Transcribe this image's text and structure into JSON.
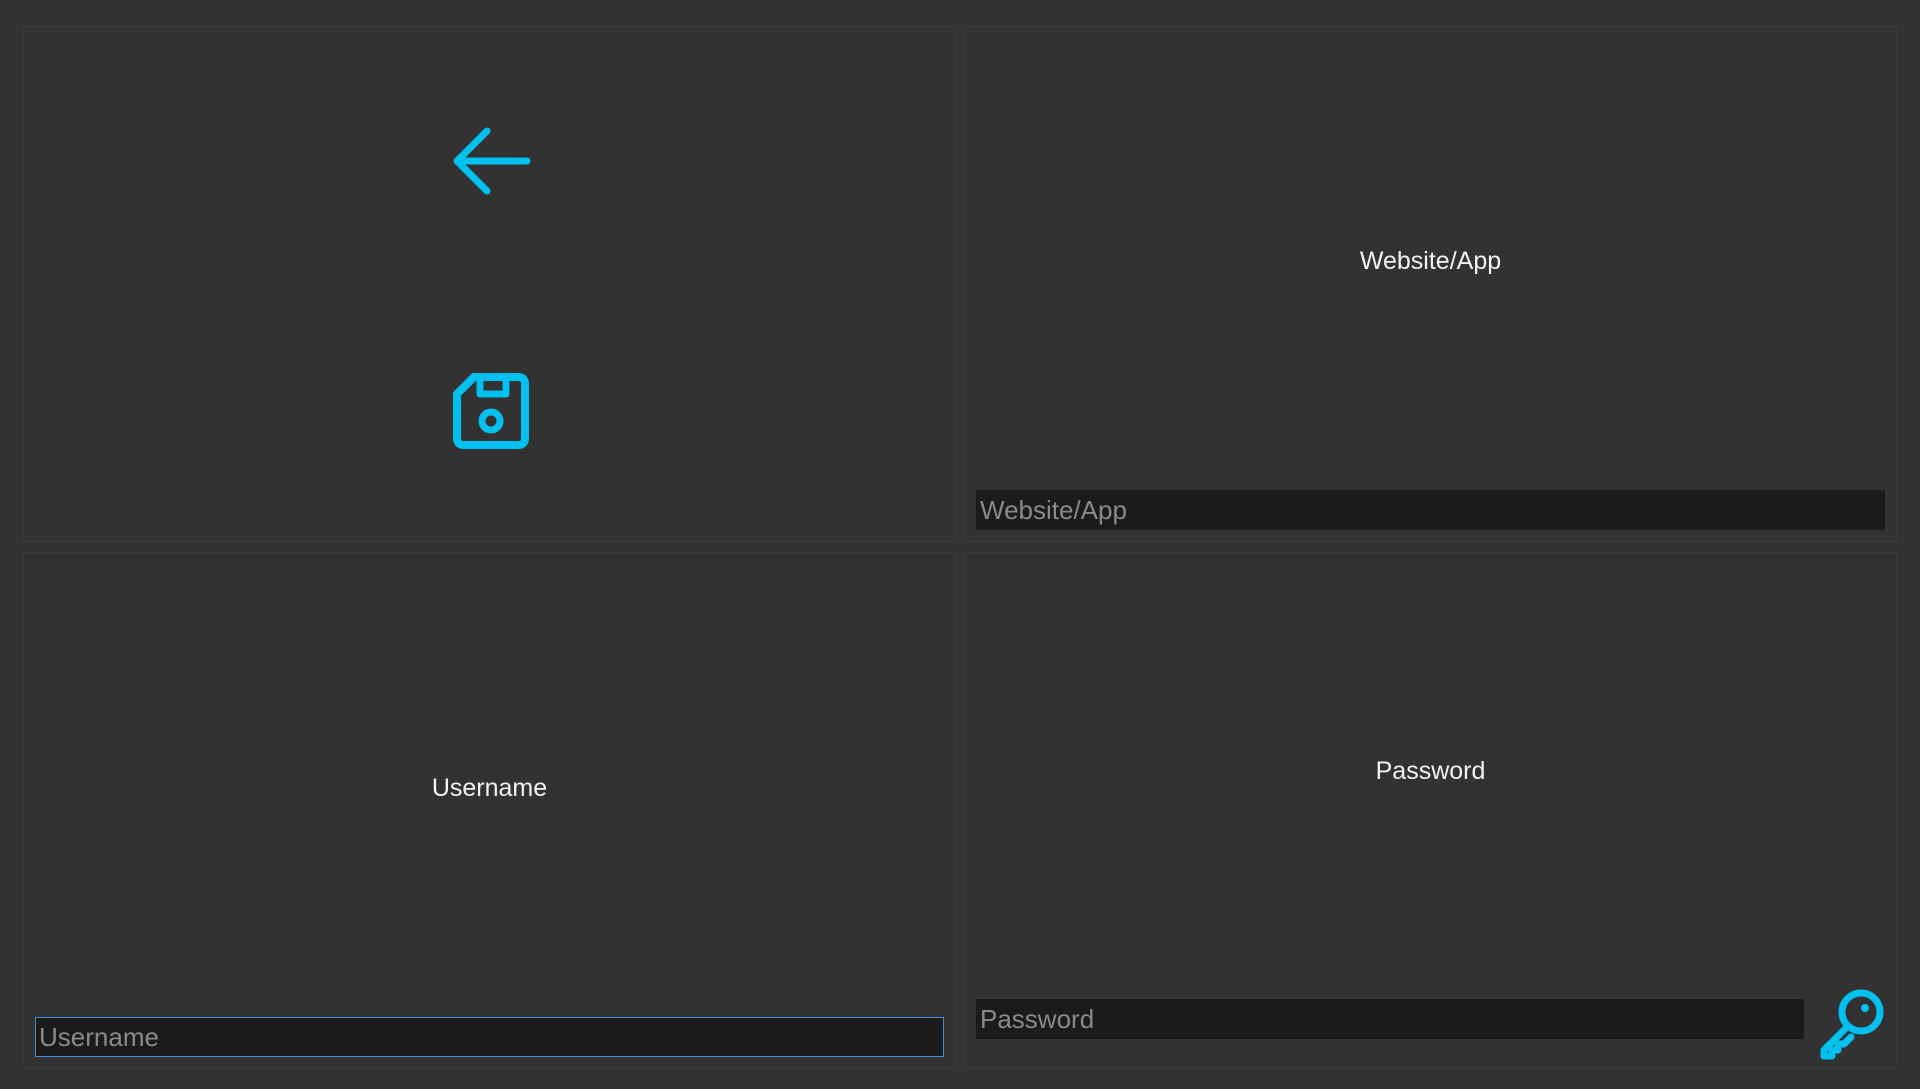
{
  "colors": {
    "background": "#323232",
    "panel_border": "#393939",
    "accent": "#00c0f0",
    "field_bg": "#1b1b1b",
    "focus_border": "#3f8fd6",
    "label_text": "#f2f2f2",
    "placeholder_text": "#8a8a8a"
  },
  "toolbar": {
    "back_icon": "arrow-left-icon",
    "save_icon": "floppy-disk-icon"
  },
  "website": {
    "label": "Website/App",
    "value": "",
    "placeholder": "Website/App"
  },
  "username": {
    "label": "Username",
    "value": "",
    "placeholder": "Username"
  },
  "password": {
    "label": "Password",
    "value": "",
    "placeholder": "Password",
    "generate_icon": "key-icon"
  }
}
